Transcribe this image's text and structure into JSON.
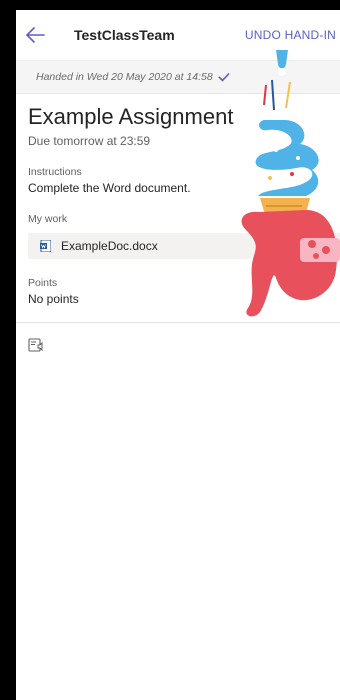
{
  "header": {
    "title": "TestClassTeam",
    "undo_label": "UNDO HAND-IN"
  },
  "banner": {
    "text": "Handed in Wed 20 May 2020 at 14:58"
  },
  "assignment": {
    "title": "Example Assignment",
    "due": "Due tomorrow at 23:59",
    "instructions_label": "Instructions",
    "instructions": "Complete the Word document.",
    "my_work_label": "My work",
    "file_name": "ExampleDoc.docx",
    "points_label": "Points",
    "points": "No points"
  },
  "colors": {
    "accent": "#5b5fc7",
    "word": "#2b579a"
  },
  "icons": {
    "back": "arrow-left-icon",
    "check": "checkmark-icon",
    "file": "word-doc-icon",
    "reader": "immersive-reader-icon"
  }
}
